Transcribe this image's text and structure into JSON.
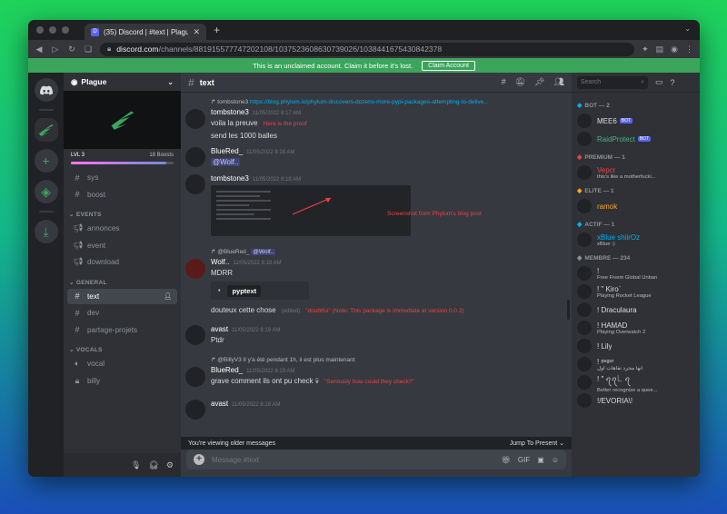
{
  "browser": {
    "tab_title": "(35) Discord | #text | Plague",
    "tab_favicon_text": "D",
    "url_host": "discord.com",
    "url_path": "/channels/881915577747202108/1037523608630739026/1038441675430842378"
  },
  "notice": {
    "text": "This is an unclaimed account. Claim it before it's lost.",
    "button": "Claim Account"
  },
  "server": {
    "name": "Plague",
    "level": "LVL 3",
    "boosts": "18 Boosts",
    "boost_progress": 0.93
  },
  "channels": {
    "top": [
      {
        "label": "sys"
      },
      {
        "label": "boost"
      }
    ],
    "categories": [
      {
        "name": "EVENTS",
        "items": [
          {
            "label": "annonces"
          },
          {
            "label": "event"
          },
          {
            "label": "download"
          }
        ]
      },
      {
        "name": "GENERAL",
        "items": [
          {
            "label": "text"
          },
          {
            "label": "dev"
          },
          {
            "label": "partage-projets"
          }
        ]
      },
      {
        "name": "VOCALS",
        "items": [
          {
            "label": "vocal"
          },
          {
            "label": "billy"
          }
        ]
      }
    ]
  },
  "chat": {
    "channel": "text",
    "messages": [
      {
        "reply_user": "tombstone3",
        "reply_link": "https://blog.phylum.io/phylum-discovers-dozens-more-pypi-packages-attempting-to-delive...",
        "author": "tombstone3",
        "time": "11/05/2022 8:17 AM",
        "line1": "voila la preuve",
        "note1": "Here is the proof",
        "line2": "send les 1000 balles"
      },
      {
        "author": "BlueRed_",
        "time": "11/05/2022 8:18 AM",
        "mention": "@Wolf.."
      },
      {
        "author": "tombstone3",
        "time": "11/05/2022 8:18 AM",
        "note": "Screenshot from Phylum's blog post"
      },
      {
        "reply_user": "@BlueRed_",
        "reply_mention": "@Wolf..",
        "author": "Wolf..",
        "time": "11/05/2022 8:18 AM",
        "text": "MDRR",
        "embed": "pyptext"
      },
      {
        "text": "douteux cette chose",
        "edited": "(edited)",
        "note": "\"doubtful\" (Note: This package is immediate at version 0.0.2)"
      },
      {
        "author": "avast",
        "time": "11/05/2022 8:19 AM",
        "text": "Ptdr"
      },
      {
        "reply_user": "@BillyV3",
        "reply_text": "Il y'a été pendant 1h, il est plus maintenant",
        "author": "BlueRed_",
        "time": "11/05/2022 8:19 AM",
        "text": "grave comment ils ont pu check",
        "note": "\"Seriously how could they check?\""
      },
      {
        "author": "avast",
        "time": "11/05/2022 8:19 AM"
      }
    ],
    "older_banner": "You're viewing older messages",
    "jump": "Jump To Present",
    "placeholder": "Message #text"
  },
  "members": {
    "search_placeholder": "Search",
    "groups": [
      {
        "name": "BOT — 2",
        "color": "#00aff4",
        "items": [
          {
            "name": "MEE6",
            "tag": "BOT",
            "color": "#dcddde"
          },
          {
            "name": "RaidProtect",
            "tag": "BOT",
            "color": "#43b581"
          }
        ]
      },
      {
        "name": "PREMIUM — 1",
        "color": "#ed4245",
        "items": [
          {
            "name": "Vepcr",
            "status": "this's like a motherfucki...",
            "color": "#ed4245"
          }
        ]
      },
      {
        "name": "ELITE — 1",
        "color": "#faa61a",
        "items": [
          {
            "name": "ramok",
            "color": "#faa61a"
          }
        ]
      },
      {
        "name": "ACTIF — 1",
        "color": "#00aff4",
        "items": [
          {
            "name": "xBlue shiirOz",
            "status": "xBlue :)",
            "color": "#00aff4"
          }
        ]
      },
      {
        "name": "MEMBRE — 234",
        "color": "#8e9297",
        "items": [
          {
            "name": "!",
            "status": "Free Fivem Global Unban",
            "color": "#dcddde"
          },
          {
            "name": "! \" Kiro`",
            "status": "Playing Rocket League",
            "color": "#dcddde"
          },
          {
            "name": "! Draculaura",
            "color": "#dcddde"
          },
          {
            "name": "! HAMAD",
            "status": "Playing Overwatch 2",
            "color": "#dcddde"
          },
          {
            "name": "! Lily",
            "color": "#dcddde"
          },
          {
            "name": "! ᵖᵉᵍᵘʳ",
            "status": "انها مجرد تفاهات اول",
            "color": "#dcddde"
          },
          {
            "name": "! \" ꪖꪖ꒒ ꪖ",
            "status": "Better recognize a quee...",
            "color": "#dcddde"
          },
          {
            "name": "!/EVORIA\\!",
            "color": "#dcddde"
          }
        ]
      }
    ]
  }
}
